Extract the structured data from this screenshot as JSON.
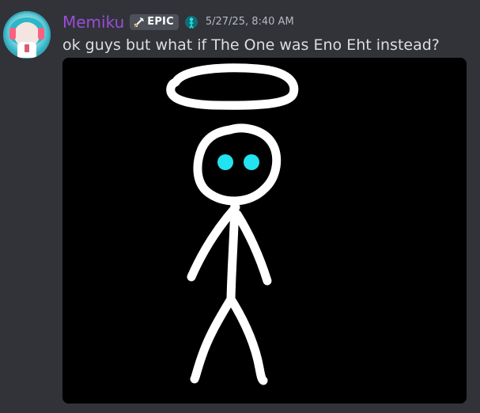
{
  "message": {
    "author": "Memiku",
    "badge": {
      "label": "EPIC",
      "icon": "sword-icon"
    },
    "role_icon": "figure-icon",
    "timestamp": "5/27/25, 8:40 AM",
    "text": "ok guys but what if The One was Eno Eht instead?"
  },
  "colors": {
    "background": "#313338",
    "username": "#9b4dd8",
    "message_text": "#dbdee1",
    "timestamp": "#b5bac1",
    "badge_background": "#4e5058",
    "image_background": "#000000",
    "stick_figure": "#ffffff",
    "eyes": "#23e3f0"
  },
  "attachment": {
    "content": "stick figure with halo",
    "avatar_icon": "anime-avatar-icon"
  }
}
